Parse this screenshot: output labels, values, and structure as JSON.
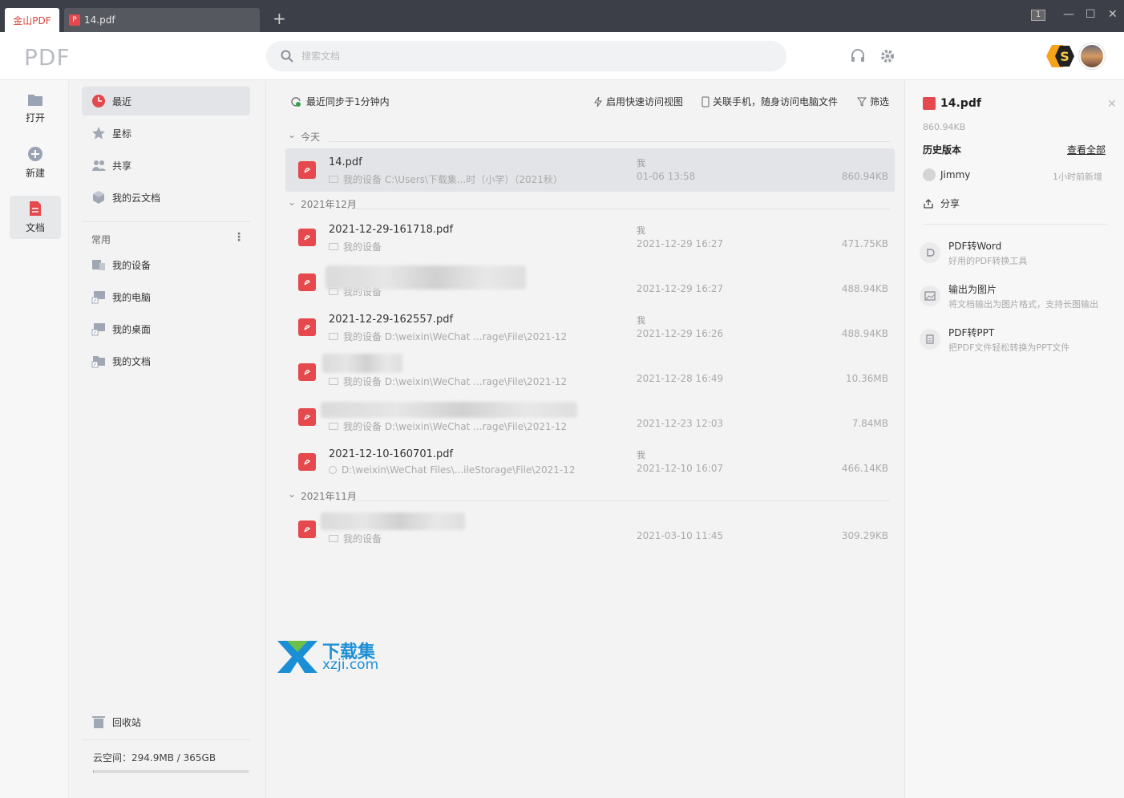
{
  "tabs": [
    {
      "label": "金山PDF"
    },
    {
      "label": "14.pdf"
    }
  ],
  "window": {
    "badge": "1"
  },
  "header": {
    "logo": "PDF",
    "search_placeholder": "搜索文档"
  },
  "rail": [
    {
      "label": "打开"
    },
    {
      "label": "新建"
    },
    {
      "label": "文档"
    }
  ],
  "nav": {
    "items": [
      {
        "label": "最近"
      },
      {
        "label": "星标"
      },
      {
        "label": "共享"
      },
      {
        "label": "我的云文档"
      }
    ],
    "group_title": "常用",
    "group_items": [
      {
        "label": "我的设备"
      },
      {
        "label": "我的电脑"
      },
      {
        "label": "我的桌面"
      },
      {
        "label": "我的文档"
      }
    ],
    "trash": "回收站",
    "storage": "云空间：294.9MB / 365GB",
    "storage_fraction": 0.0008
  },
  "toolbar": {
    "sync": "最近同步于1分钟内",
    "quick_view": "启用快速访问视图",
    "phone": "关联手机，随身访问电脑文件",
    "filter": "筛选"
  },
  "groups": [
    {
      "label": "今天"
    },
    {
      "label": "2021年12月"
    },
    {
      "label": "2021年11月"
    }
  ],
  "files": [
    {
      "name": "14.pdf",
      "path": "我的设备 C:\\Users\\下载集...时（小学）（2021秋）",
      "owner": "我",
      "time": "01-06 13:58",
      "size": "860.94KB"
    },
    {
      "name": "2021-12-29-161718.pdf",
      "path": "我的设备",
      "owner": "我",
      "time": "2021-12-29 16:27",
      "size": "471.75KB"
    },
    {
      "name": "",
      "path": "我的设备",
      "owner": "",
      "time": "2021-12-29 16:27",
      "size": "488.94KB"
    },
    {
      "name": "2021-12-29-162557.pdf",
      "path": "我的设备 D:\\weixin\\WeChat ...rage\\File\\2021-12",
      "owner": "我",
      "time": "2021-12-29 16:26",
      "size": "488.94KB"
    },
    {
      "name": "",
      "path": "我的设备 D:\\weixin\\WeChat ...rage\\File\\2021-12",
      "owner": "",
      "time": "2021-12-28 16:49",
      "size": "10.36MB"
    },
    {
      "name": "",
      "path": "我的设备 D:\\weixin\\WeChat ...rage\\File\\2021-12",
      "owner": "",
      "time": "2021-12-23 12:03",
      "size": "7.84MB"
    },
    {
      "name": "2021-12-10-160701.pdf",
      "path": "D:\\weixin\\WeChat Files\\...ileStorage\\File\\2021-12",
      "owner": "我",
      "time": "2021-12-10 16:07",
      "size": "466.14KB"
    },
    {
      "name": "",
      "path": "我的设备",
      "owner": "",
      "time": "2021-03-10 11:45",
      "size": "309.29KB"
    }
  ],
  "watermark": {
    "line1": "下载集",
    "line2": "xzji.com"
  },
  "detail": {
    "title": "14.pdf",
    "size": "860.94KB",
    "history": "历史版本",
    "view_all": "查看全部",
    "user": "Jimmy",
    "when": "1小时前新增",
    "share": "分享",
    "tools": [
      {
        "title": "PDF转Word",
        "desc": "好用的PDF转换工具"
      },
      {
        "title": "输出为图片",
        "desc": "将文档输出为图片格式，支持长图输出"
      },
      {
        "title": "PDF转PPT",
        "desc": "把PDF文件轻松转换为PPT文件"
      }
    ]
  },
  "colors": {
    "accent": "#e5484d",
    "titlebar": "#3c3f47"
  }
}
